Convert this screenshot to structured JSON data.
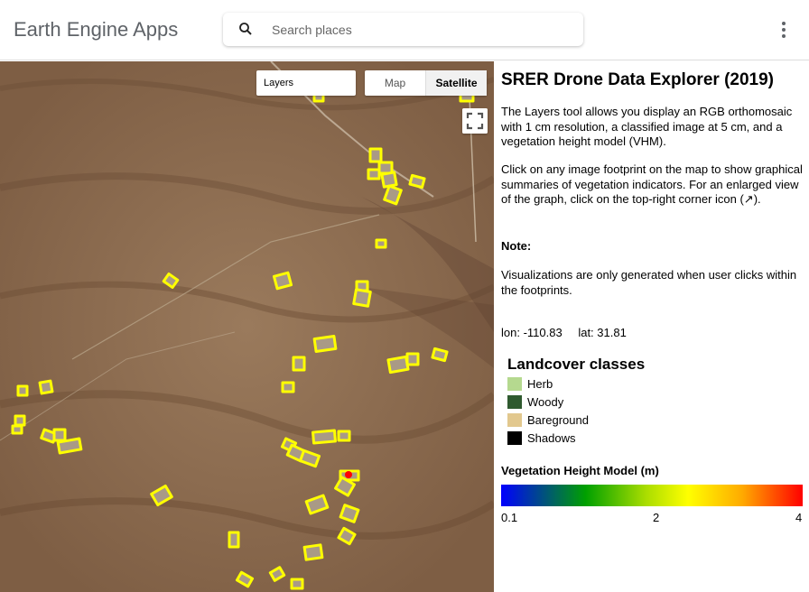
{
  "header": {
    "app_title": "Earth Engine Apps",
    "search_placeholder": "Search places",
    "search_icon": "search-icon",
    "menu_icon": "more-vert-icon"
  },
  "map": {
    "layers_label": "Layers",
    "maptype_map": "Map",
    "maptype_satellite": "Satellite",
    "active_maptype": "Satellite",
    "footprint_color": "#ffff00",
    "selected_point_color": "#ff0000"
  },
  "panel": {
    "title": "SRER Drone Data Explorer (2019)",
    "para1": "The Layers tool allows you display an RGB orthomosaic with 1 cm resolution, a classified image at 5 cm, and a vegetation height model (VHM).",
    "para2": "Click on any image footprint on the map to show graphical summaries of vegetation indicators. For an enlarged view of the graph, click on the top-right corner icon (↗).",
    "note_label": "Note:",
    "para3": "Visualizations are only generated when user clicks within the footprints.",
    "lon": "lon: -110.83",
    "lat": "lat: 31.81",
    "legend_title": "Landcover classes",
    "legend": [
      {
        "label": "Herb",
        "color": "#b5d98f"
      },
      {
        "label": "Woody",
        "color": "#2f5a2f"
      },
      {
        "label": "Bareground",
        "color": "#e2c88e"
      },
      {
        "label": "Shadows",
        "color": "#000000"
      }
    ],
    "vhm_title": "Vegetation Height Model (m)",
    "vhm_ticks": [
      "0.1",
      "2",
      "4"
    ]
  }
}
